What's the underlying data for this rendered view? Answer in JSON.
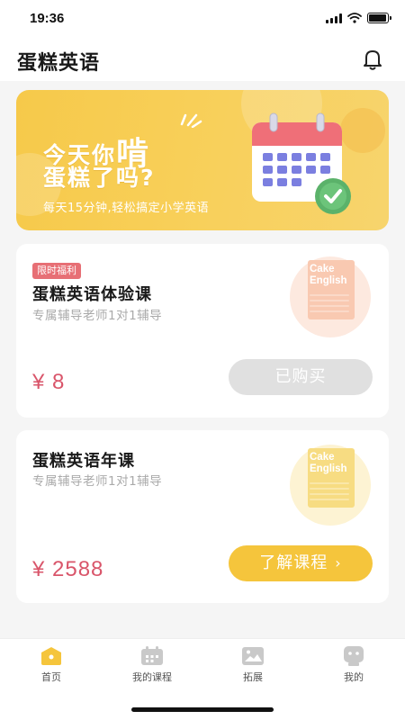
{
  "status": {
    "time": "19:36",
    "battery_level": 0.95
  },
  "header": {
    "title": "蛋糕英语",
    "bell_icon": "bell-icon"
  },
  "banner": {
    "line1_prefix": "今天你",
    "line1_big": "啃",
    "line2": "蛋糕了吗?",
    "subtitle": "每天15分钟,轻松搞定小学英语",
    "illustration_icon": "calendar-check-icon"
  },
  "courses": [
    {
      "tag": "限时福利",
      "title": "蛋糕英语体验课",
      "subtitle": "专属辅导老师1对1辅导",
      "price": "¥ 8",
      "button": "已购买",
      "thumb_text_1": "Cake",
      "thumb_text_2": "English",
      "accent": "#f6b7a1"
    },
    {
      "title": "蛋糕英语年课",
      "subtitle": "专属辅导老师1对1辅导",
      "price": "¥ 2588",
      "button": "了解课程",
      "button_chevron": "›",
      "thumb_text_1": "Cake",
      "thumb_text_2": "English",
      "accent": "#f6d77a"
    }
  ],
  "tabs": [
    {
      "label": "首页",
      "icon": "home-icon",
      "active": true
    },
    {
      "label": "我的课程",
      "icon": "calendar-icon",
      "active": false
    },
    {
      "label": "拓展",
      "icon": "picture-icon",
      "active": false
    },
    {
      "label": "我的",
      "icon": "profile-icon",
      "active": false
    }
  ],
  "colors": {
    "accent_yellow": "#f5c53c",
    "price_red": "#d9556a",
    "tag_red": "#e76f75"
  }
}
